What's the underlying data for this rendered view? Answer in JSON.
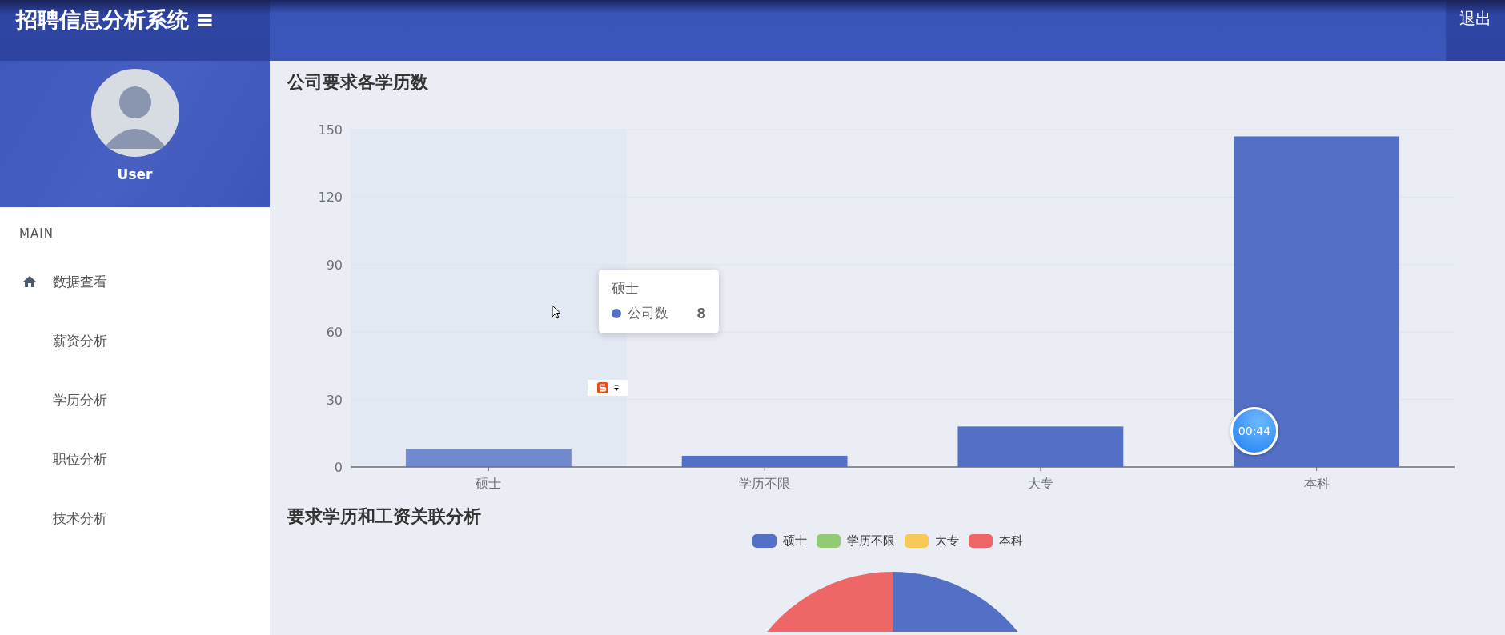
{
  "header": {
    "title": "招聘信息分析系统",
    "menu_glyph": "≡",
    "logout": "退出"
  },
  "profile": {
    "name": "User"
  },
  "sidebar": {
    "section": "MAIN",
    "items": [
      {
        "label": "数据查看",
        "kind": "icon"
      },
      {
        "label": "薪资分析",
        "kind": "plain"
      },
      {
        "label": "学历分析",
        "kind": "plain"
      },
      {
        "label": "职位分析",
        "kind": "plain"
      },
      {
        "label": "技术分析",
        "kind": "plain"
      }
    ]
  },
  "bar_section": {
    "title": "公司要求各学历数",
    "chart_data": {
      "type": "bar",
      "grid": true,
      "categories": [
        "硕士",
        "学历不限",
        "大专",
        "本科"
      ],
      "series": [
        {
          "name": "公司数",
          "color": "#5470c6",
          "values": [
            8,
            5,
            18,
            147
          ]
        }
      ],
      "ylim": [
        0,
        150
      ],
      "yticks": [
        0,
        30,
        60,
        90,
        120,
        150
      ]
    },
    "tooltip": {
      "title": "硕士",
      "value": "8"
    }
  },
  "pie_section": {
    "title": "要求学历和工资关联分析",
    "legend": [
      {
        "label": "硕士",
        "color": "#5470c6"
      },
      {
        "label": "学历不限",
        "color": "#91cc75"
      },
      {
        "label": "大专",
        "color": "#fac858"
      },
      {
        "label": "本科",
        "color": "#ee6666"
      }
    ]
  },
  "recording_timer": "00:44"
}
